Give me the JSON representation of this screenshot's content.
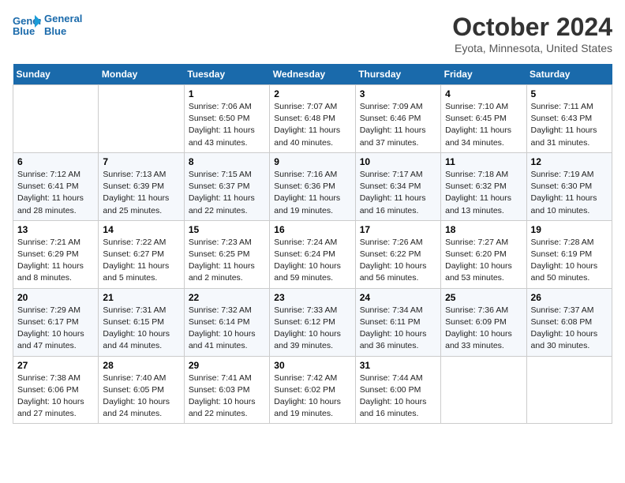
{
  "header": {
    "logo_line1": "General",
    "logo_line2": "Blue",
    "month_title": "October 2024",
    "location": "Eyota, Minnesota, United States"
  },
  "days_of_week": [
    "Sunday",
    "Monday",
    "Tuesday",
    "Wednesday",
    "Thursday",
    "Friday",
    "Saturday"
  ],
  "weeks": [
    [
      {
        "day": "",
        "info": ""
      },
      {
        "day": "",
        "info": ""
      },
      {
        "day": "1",
        "info": "Sunrise: 7:06 AM\nSunset: 6:50 PM\nDaylight: 11 hours and 43 minutes."
      },
      {
        "day": "2",
        "info": "Sunrise: 7:07 AM\nSunset: 6:48 PM\nDaylight: 11 hours and 40 minutes."
      },
      {
        "day": "3",
        "info": "Sunrise: 7:09 AM\nSunset: 6:46 PM\nDaylight: 11 hours and 37 minutes."
      },
      {
        "day": "4",
        "info": "Sunrise: 7:10 AM\nSunset: 6:45 PM\nDaylight: 11 hours and 34 minutes."
      },
      {
        "day": "5",
        "info": "Sunrise: 7:11 AM\nSunset: 6:43 PM\nDaylight: 11 hours and 31 minutes."
      }
    ],
    [
      {
        "day": "6",
        "info": "Sunrise: 7:12 AM\nSunset: 6:41 PM\nDaylight: 11 hours and 28 minutes."
      },
      {
        "day": "7",
        "info": "Sunrise: 7:13 AM\nSunset: 6:39 PM\nDaylight: 11 hours and 25 minutes."
      },
      {
        "day": "8",
        "info": "Sunrise: 7:15 AM\nSunset: 6:37 PM\nDaylight: 11 hours and 22 minutes."
      },
      {
        "day": "9",
        "info": "Sunrise: 7:16 AM\nSunset: 6:36 PM\nDaylight: 11 hours and 19 minutes."
      },
      {
        "day": "10",
        "info": "Sunrise: 7:17 AM\nSunset: 6:34 PM\nDaylight: 11 hours and 16 minutes."
      },
      {
        "day": "11",
        "info": "Sunrise: 7:18 AM\nSunset: 6:32 PM\nDaylight: 11 hours and 13 minutes."
      },
      {
        "day": "12",
        "info": "Sunrise: 7:19 AM\nSunset: 6:30 PM\nDaylight: 11 hours and 10 minutes."
      }
    ],
    [
      {
        "day": "13",
        "info": "Sunrise: 7:21 AM\nSunset: 6:29 PM\nDaylight: 11 hours and 8 minutes."
      },
      {
        "day": "14",
        "info": "Sunrise: 7:22 AM\nSunset: 6:27 PM\nDaylight: 11 hours and 5 minutes."
      },
      {
        "day": "15",
        "info": "Sunrise: 7:23 AM\nSunset: 6:25 PM\nDaylight: 11 hours and 2 minutes."
      },
      {
        "day": "16",
        "info": "Sunrise: 7:24 AM\nSunset: 6:24 PM\nDaylight: 10 hours and 59 minutes."
      },
      {
        "day": "17",
        "info": "Sunrise: 7:26 AM\nSunset: 6:22 PM\nDaylight: 10 hours and 56 minutes."
      },
      {
        "day": "18",
        "info": "Sunrise: 7:27 AM\nSunset: 6:20 PM\nDaylight: 10 hours and 53 minutes."
      },
      {
        "day": "19",
        "info": "Sunrise: 7:28 AM\nSunset: 6:19 PM\nDaylight: 10 hours and 50 minutes."
      }
    ],
    [
      {
        "day": "20",
        "info": "Sunrise: 7:29 AM\nSunset: 6:17 PM\nDaylight: 10 hours and 47 minutes."
      },
      {
        "day": "21",
        "info": "Sunrise: 7:31 AM\nSunset: 6:15 PM\nDaylight: 10 hours and 44 minutes."
      },
      {
        "day": "22",
        "info": "Sunrise: 7:32 AM\nSunset: 6:14 PM\nDaylight: 10 hours and 41 minutes."
      },
      {
        "day": "23",
        "info": "Sunrise: 7:33 AM\nSunset: 6:12 PM\nDaylight: 10 hours and 39 minutes."
      },
      {
        "day": "24",
        "info": "Sunrise: 7:34 AM\nSunset: 6:11 PM\nDaylight: 10 hours and 36 minutes."
      },
      {
        "day": "25",
        "info": "Sunrise: 7:36 AM\nSunset: 6:09 PM\nDaylight: 10 hours and 33 minutes."
      },
      {
        "day": "26",
        "info": "Sunrise: 7:37 AM\nSunset: 6:08 PM\nDaylight: 10 hours and 30 minutes."
      }
    ],
    [
      {
        "day": "27",
        "info": "Sunrise: 7:38 AM\nSunset: 6:06 PM\nDaylight: 10 hours and 27 minutes."
      },
      {
        "day": "28",
        "info": "Sunrise: 7:40 AM\nSunset: 6:05 PM\nDaylight: 10 hours and 24 minutes."
      },
      {
        "day": "29",
        "info": "Sunrise: 7:41 AM\nSunset: 6:03 PM\nDaylight: 10 hours and 22 minutes."
      },
      {
        "day": "30",
        "info": "Sunrise: 7:42 AM\nSunset: 6:02 PM\nDaylight: 10 hours and 19 minutes."
      },
      {
        "day": "31",
        "info": "Sunrise: 7:44 AM\nSunset: 6:00 PM\nDaylight: 10 hours and 16 minutes."
      },
      {
        "day": "",
        "info": ""
      },
      {
        "day": "",
        "info": ""
      }
    ]
  ]
}
